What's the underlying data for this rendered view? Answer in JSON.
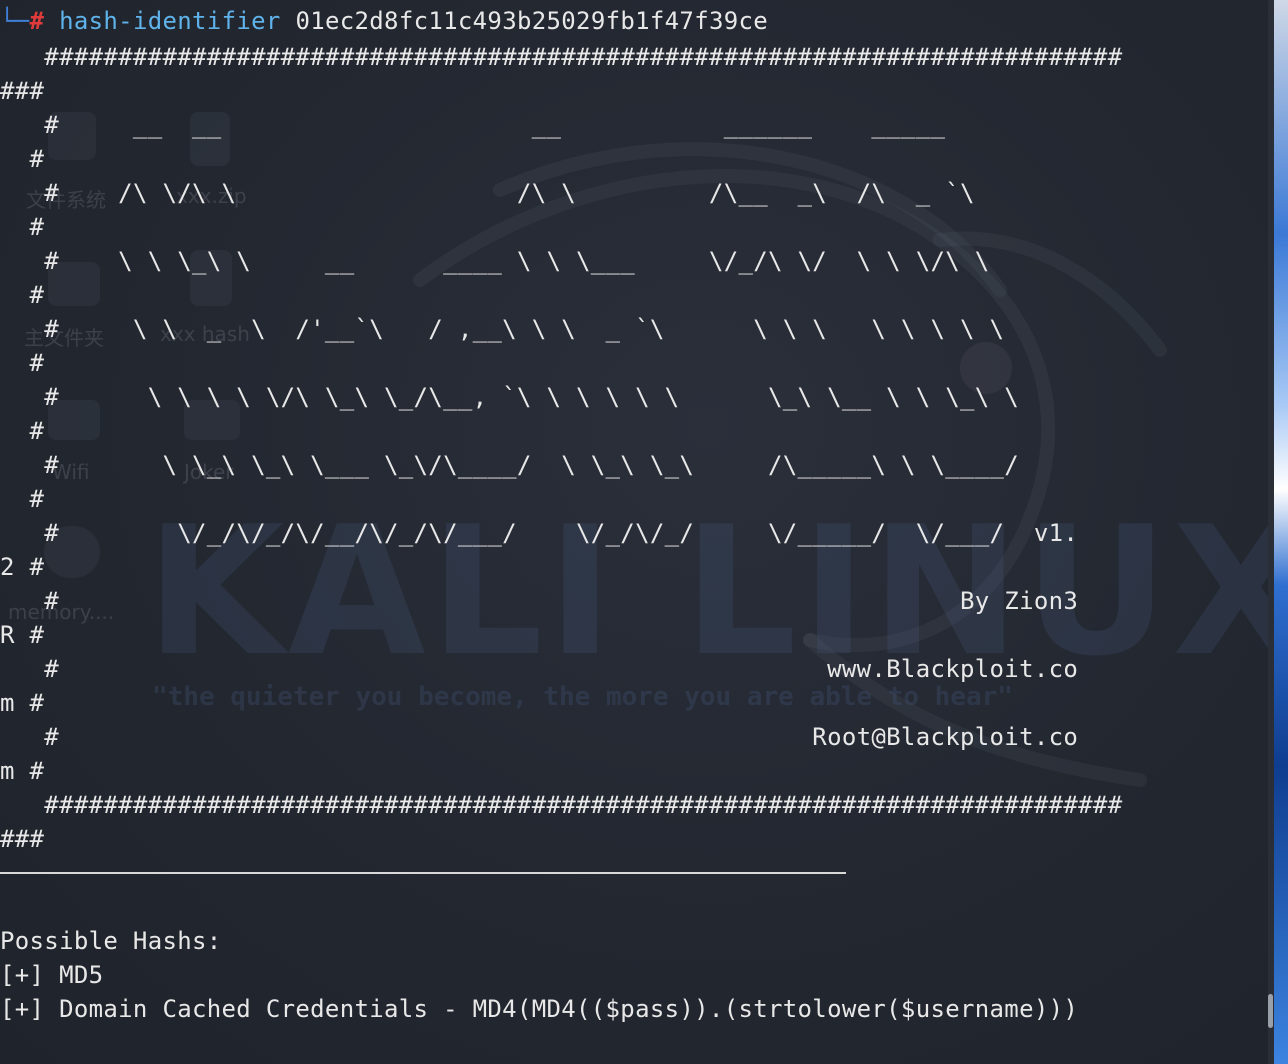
{
  "theme": {
    "background": "#232730",
    "text": "#e8e8e8",
    "prompt_corner": "#3f7fd6",
    "prompt_hash": "#e03b3b",
    "command": "#5fb3ea"
  },
  "desktop": {
    "icons": [
      "文件系统",
      "xxx.zip",
      "主文件夹",
      "xxx hash",
      "Wifi",
      "Joker",
      "memory...."
    ],
    "wordmark": "KALI LINUX",
    "tagline": "\"the quieter you become, the more you are able to hear\""
  },
  "prompt": {
    "corner": "└─",
    "symbol": "#",
    "command": "hash-identifier",
    "argument": "01ec2d8fc11c493b25029fb1f47f39ce"
  },
  "banner": [
    "   #########################################################################",
    "###",
    "   #     __  __                     __           ______    _____",
    "  #",
    "   #    /\\ \\/\\ \\                   /\\ \\         /\\__  _\\  /\\  _ `\\",
    "  #",
    "   #    \\ \\ \\_\\ \\     __      ____ \\ \\ \\___     \\/_/\\ \\/  \\ \\ \\/\\ \\",
    "  #",
    "   #     \\ \\  _  \\  /'__`\\   / ,__\\ \\ \\  _ `\\      \\ \\ \\   \\ \\ \\ \\ \\",
    "  #",
    "   #      \\ \\ \\ \\ \\/\\ \\_\\ \\_/\\__, `\\ \\ \\ \\ \\ \\      \\_\\ \\__ \\ \\ \\_\\ \\",
    "  #",
    "   #       \\ \\_\\ \\_\\ \\___ \\_\\/\\____/  \\ \\_\\ \\_\\     /\\_____\\ \\ \\____/",
    "  #",
    "   #        \\/_/\\/_/\\/__/\\/_/\\/___/    \\/_/\\/_/     \\/_____/  \\/___/  v1.",
    "2 #",
    "   #                                                             By Zion3",
    "R #",
    "   #                                                    www.Blackploit.co",
    "m #",
    "   #                                                   Root@Blackploit.co",
    "m #",
    "   #########################################################################",
    "###"
  ],
  "results": {
    "heading": "Possible Hashs:",
    "items": [
      "[+] MD5",
      "[+] Domain Cached Credentials - MD4(MD4(($pass)).(strtolower($username)))"
    ]
  }
}
